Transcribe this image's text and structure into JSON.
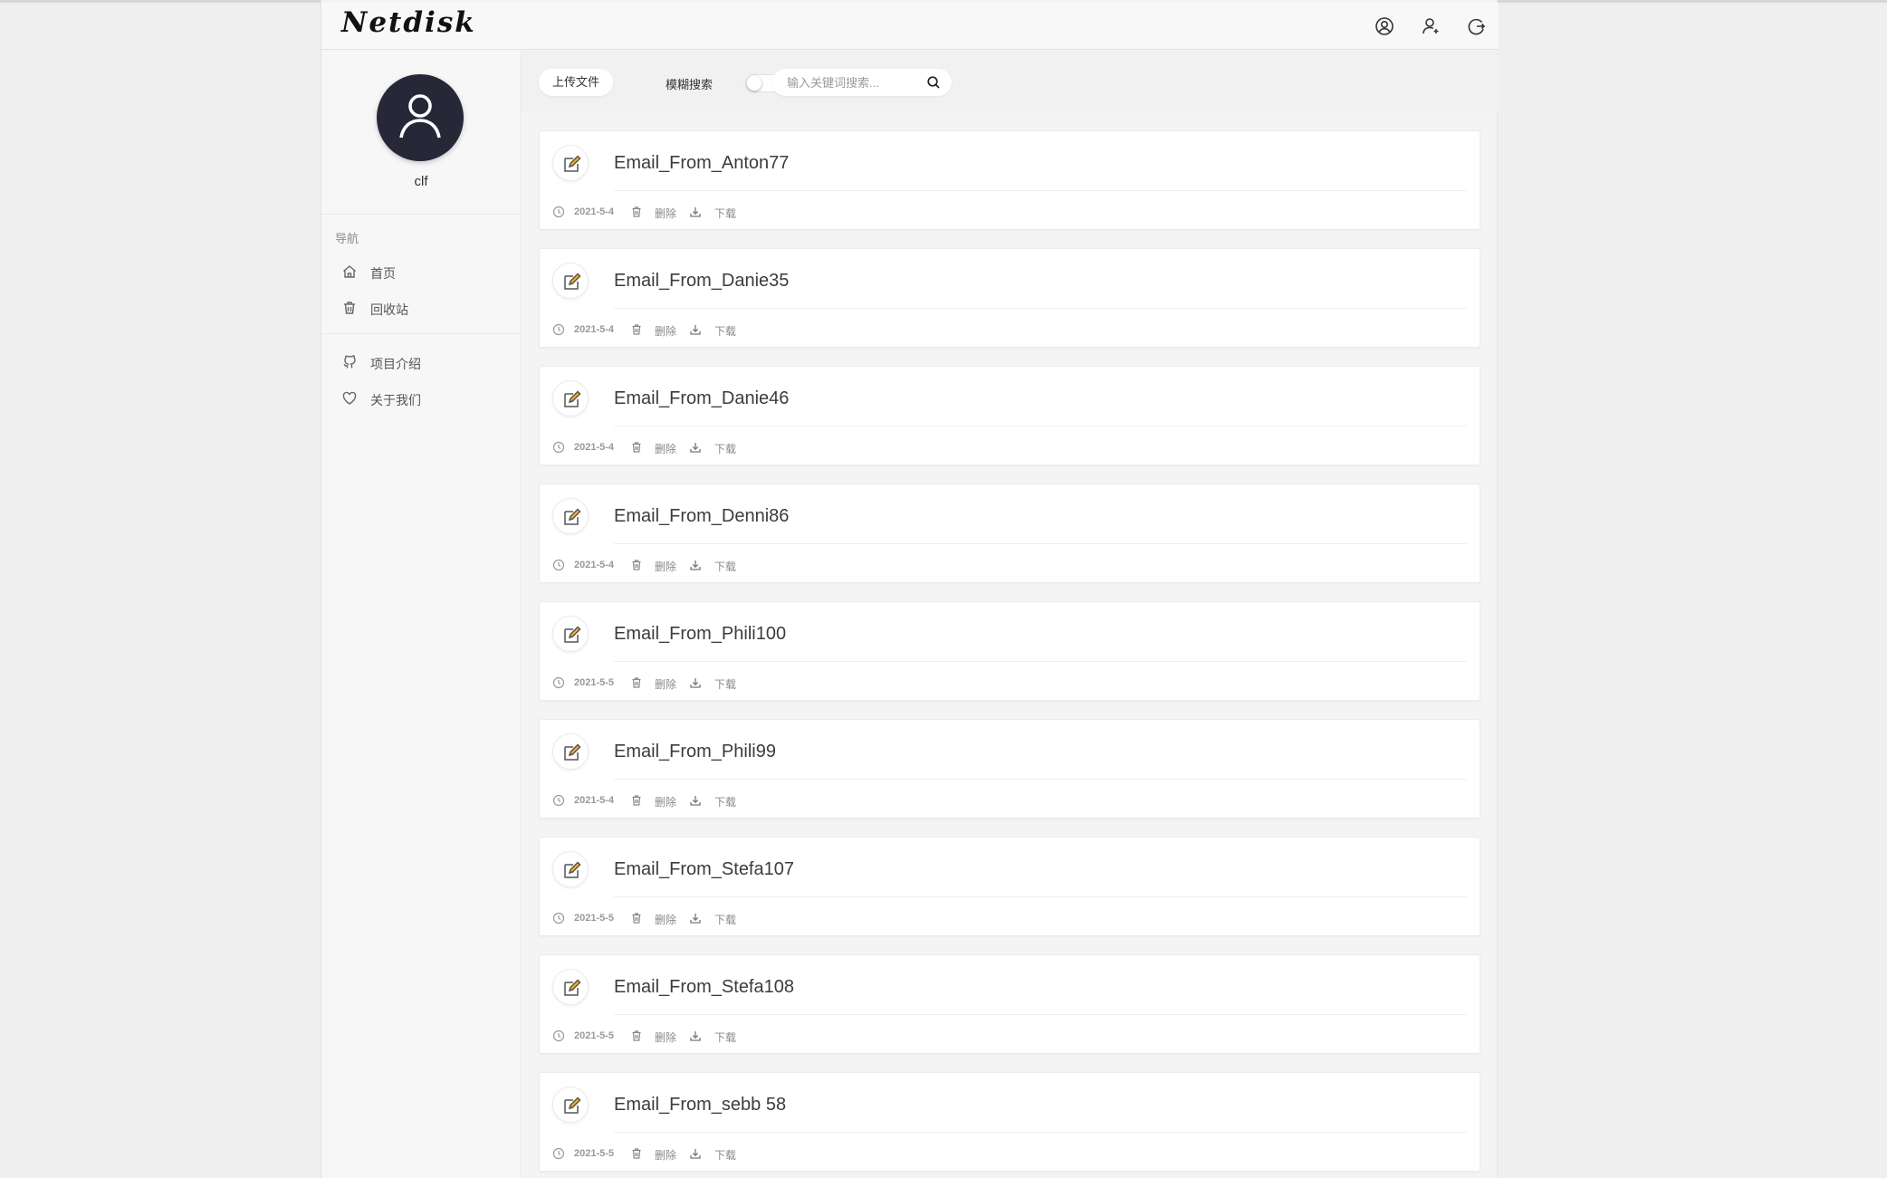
{
  "header": {
    "logo": "Netdisk",
    "icons": [
      "user-circle-icon",
      "user-add-icon",
      "logout-icon"
    ]
  },
  "sidebar": {
    "username": "clf",
    "nav_heading": "导航",
    "items": [
      {
        "label": "首页",
        "icon": "home-icon"
      },
      {
        "label": "回收站",
        "icon": "trash-icon"
      },
      {
        "label": "项目介绍",
        "icon": "github-icon"
      },
      {
        "label": "关于我们",
        "icon": "heart-icon"
      }
    ]
  },
  "toolbar": {
    "upload_label": "上传文件",
    "fuzzy_label": "模糊搜索",
    "fuzzy_enabled": false,
    "search_placeholder": "输入关键词搜索...",
    "search_value": ""
  },
  "file_actions": {
    "delete_label": "删除",
    "download_label": "下载"
  },
  "files": [
    {
      "name": "Email_From_Anton77",
      "date": "2021-5-4"
    },
    {
      "name": "Email_From_Danie35",
      "date": "2021-5-4"
    },
    {
      "name": "Email_From_Danie46",
      "date": "2021-5-4"
    },
    {
      "name": "Email_From_Denni86",
      "date": "2021-5-4"
    },
    {
      "name": "Email_From_Phili100",
      "date": "2021-5-5"
    },
    {
      "name": "Email_From_Phili99",
      "date": "2021-5-4"
    },
    {
      "name": "Email_From_Stefa107",
      "date": "2021-5-5"
    },
    {
      "name": "Email_From_Stefa108",
      "date": "2021-5-5"
    },
    {
      "name": "Email_From_sebb 58",
      "date": "2021-5-5"
    }
  ]
}
